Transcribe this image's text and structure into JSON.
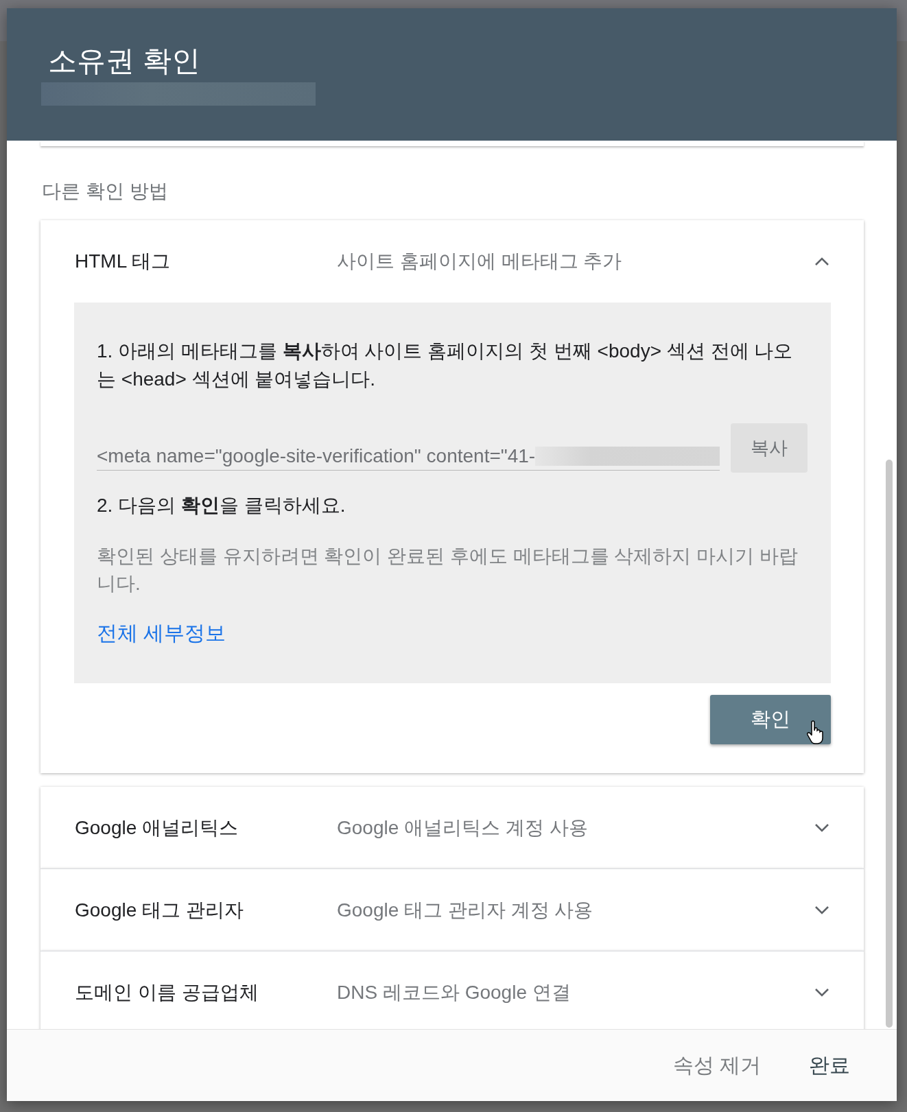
{
  "dialog": {
    "title": "소유권 확인",
    "section_heading": "다른 확인 방법",
    "methods": [
      {
        "title": "HTML 태그",
        "description": "사이트 홈페이지에 메타태그 추가",
        "expanded": true,
        "content": {
          "step_1": "1. 아래의 메타태그를 **복사**하여 사이트 홈페이지의 첫 번째 <body> 섹션 전에 나오는 <head> 섹션에 붙여넣습니다.",
          "code_value": "<meta name=\"google-site-verification\" content=\"41-",
          "copy_button": "복사",
          "step_2": "2. 다음의 **확인**을 클릭하세요.",
          "note": "확인된 상태를 유지하려면 확인이 완료된 후에도 메타태그를 삭제하지 마시기 바랍니다.",
          "details_link": "전체 세부정보",
          "verify_button": "확인"
        }
      },
      {
        "title": "Google 애널리틱스",
        "description": "Google 애널리틱스 계정 사용",
        "expanded": false
      },
      {
        "title": "Google 태그 관리자",
        "description": "Google 태그 관리자 계정 사용",
        "expanded": false
      },
      {
        "title": "도메인 이름 공급업체",
        "description": "DNS 레코드와 Google 연결",
        "expanded": false
      }
    ],
    "footer_buttons": [
      "속성 제거",
      "완료"
    ]
  }
}
